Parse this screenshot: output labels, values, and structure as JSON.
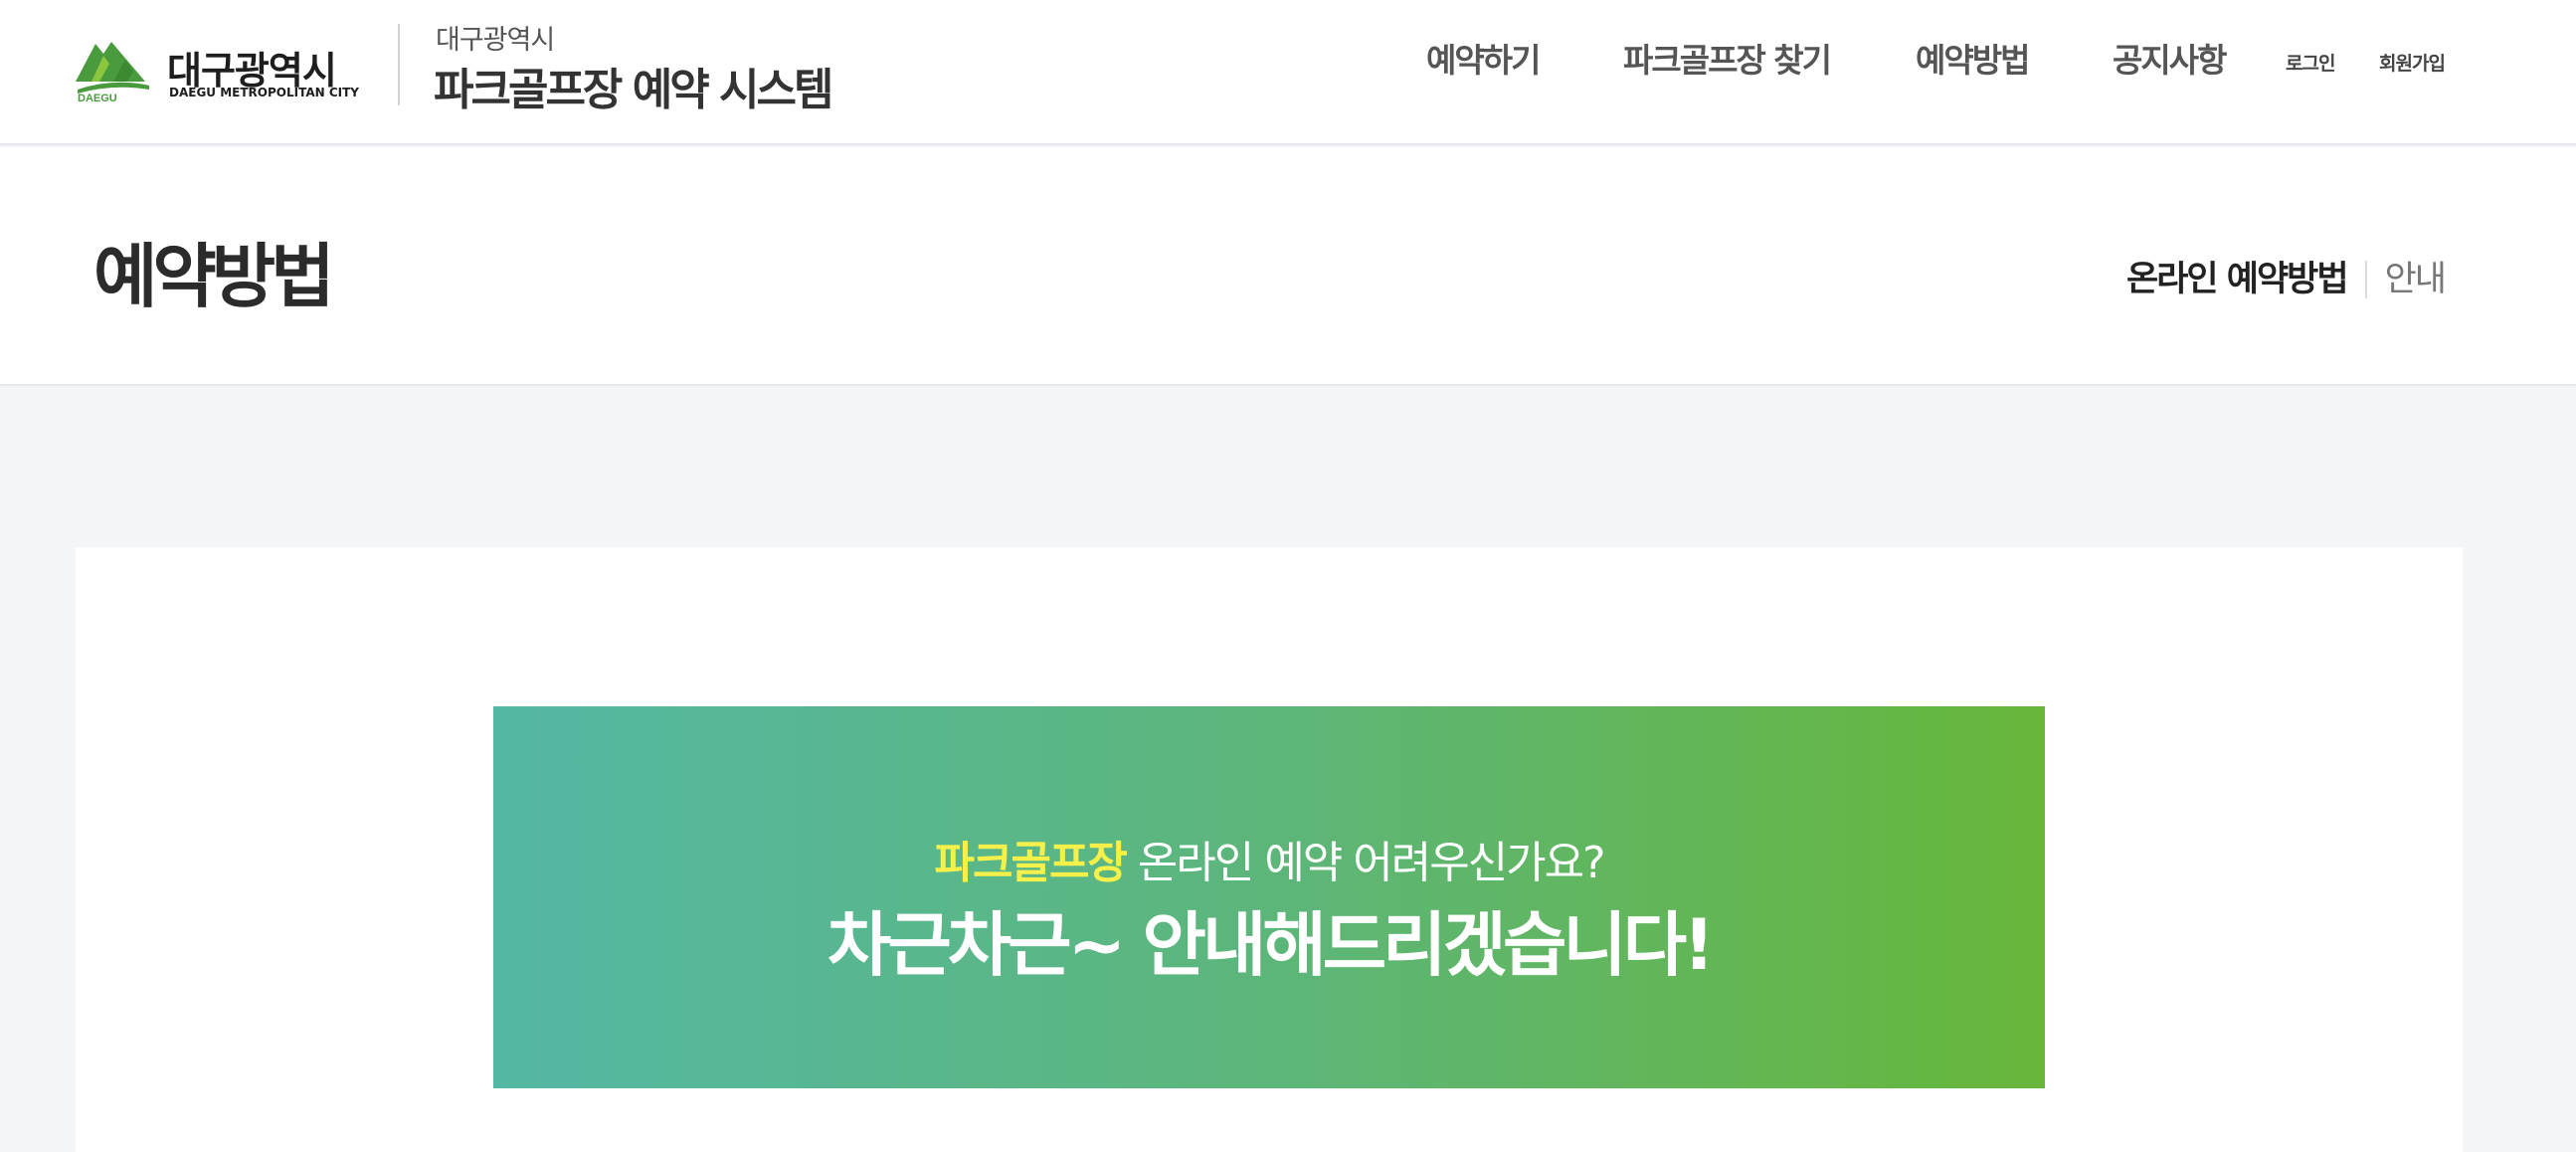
{
  "header": {
    "logo": {
      "name_ko": "대구광역시",
      "name_en": "DAEGU METROPOLITAN CITY",
      "mark_text": "DAEGU",
      "brand_green": "#4a9a3e"
    },
    "system_city": "대구광역시",
    "system_title": "파크골프장 예약 시스템",
    "nav": [
      {
        "label": "예약하기"
      },
      {
        "label": "파크골프장 찾기"
      },
      {
        "label": "예약방법"
      },
      {
        "label": "공지사항"
      }
    ],
    "util": {
      "login": "로그인",
      "signup": "회원가입"
    }
  },
  "page": {
    "title": "예약방법",
    "tabs": [
      {
        "label": "온라인 예약방법",
        "active": true
      },
      {
        "label": "안내",
        "active": false
      }
    ]
  },
  "banner": {
    "highlight": "파크골프장",
    "line1_rest": " 온라인 예약 어려우신가요?",
    "line2": "차근차근~ 안내해드리겠습니다!",
    "gradient_start": "#55b8a4",
    "gradient_end": "#68b63a",
    "highlight_color": "#f5f04a"
  }
}
